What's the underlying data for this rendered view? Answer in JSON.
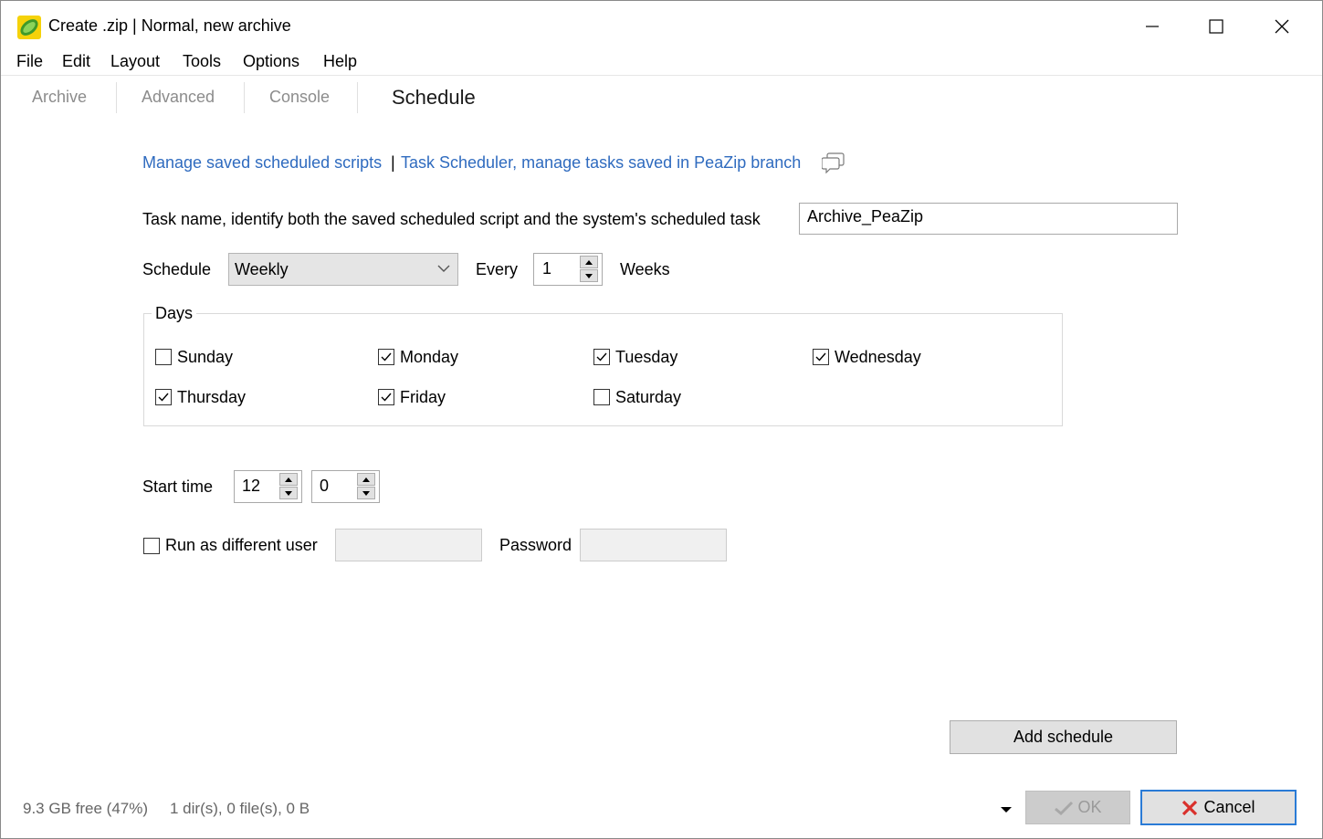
{
  "window": {
    "title": "Create .zip | Normal, new archive",
    "minimize_label": "",
    "maximize_label": "",
    "close_label": ""
  },
  "menu": [
    "File",
    "Edit",
    "Layout",
    "Tools",
    "Options",
    "Help"
  ],
  "tabs": [
    {
      "label": "Archive",
      "active": false
    },
    {
      "label": "Advanced",
      "active": false
    },
    {
      "label": "Console",
      "active": false
    },
    {
      "label": "Schedule",
      "active": true
    }
  ],
  "links": {
    "manage_scripts": "Manage saved scheduled scripts",
    "separator": "|",
    "task_scheduler": "Task Scheduler, manage tasks saved in PeaZip branch"
  },
  "task": {
    "label": "Task name, identify both the saved scheduled script and the system's scheduled task",
    "value": "Archive_PeaZip"
  },
  "schedule": {
    "label": "Schedule",
    "selected": "Weekly",
    "every_label": "Every",
    "every_value": "1",
    "unit_label": "Weeks"
  },
  "days": {
    "title": "Days",
    "items": [
      {
        "label": "Sunday",
        "checked": false
      },
      {
        "label": "Monday",
        "checked": true
      },
      {
        "label": "Tuesday",
        "checked": true
      },
      {
        "label": "Wednesday",
        "checked": true
      },
      {
        "label": "Thursday",
        "checked": true
      },
      {
        "label": "Friday",
        "checked": true
      },
      {
        "label": "Saturday",
        "checked": false
      }
    ]
  },
  "start_time": {
    "label": "Start time",
    "hour": "12",
    "minute": "0"
  },
  "run_as": {
    "label": "Run as different user",
    "checked": false,
    "user_value": "",
    "password_label": "Password",
    "password_value": ""
  },
  "buttons": {
    "add_schedule": "Add schedule",
    "ok": "OK",
    "cancel": "Cancel"
  },
  "status": {
    "free_space": "9.3 GB free (47%)",
    "selection": "1 dir(s), 0 file(s), 0 B"
  },
  "colors": {
    "link": "#2f6bbf",
    "cancel_icon": "#d9302c",
    "ok_icon": "#a8a8a8",
    "app_icon": "#6cc24a"
  }
}
